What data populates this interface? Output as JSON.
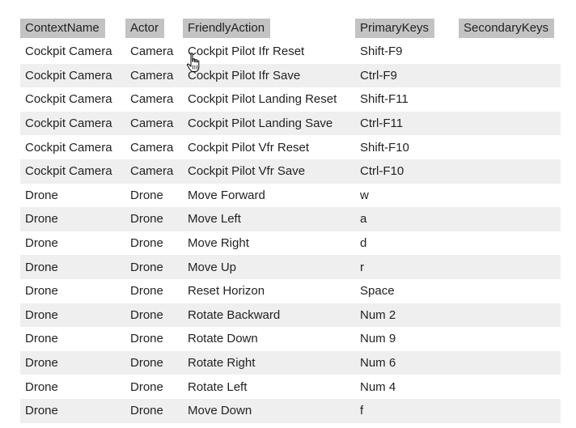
{
  "columns": [
    "ContextName",
    "Actor",
    "FriendlyAction",
    "PrimaryKeys",
    "SecondaryKeys"
  ],
  "rows": [
    [
      "Cockpit Camera",
      "Camera",
      "Cockpit Pilot Ifr Reset",
      "Shift-F9",
      ""
    ],
    [
      "Cockpit Camera",
      "Camera",
      "Cockpit Pilot Ifr Save",
      "Ctrl-F9",
      ""
    ],
    [
      "Cockpit Camera",
      "Camera",
      "Cockpit Pilot Landing Reset",
      "Shift-F11",
      ""
    ],
    [
      "Cockpit Camera",
      "Camera",
      "Cockpit Pilot Landing Save",
      "Ctrl-F11",
      ""
    ],
    [
      "Cockpit Camera",
      "Camera",
      "Cockpit Pilot Vfr Reset",
      "Shift-F10",
      ""
    ],
    [
      "Cockpit Camera",
      "Camera",
      "Cockpit Pilot Vfr Save",
      "Ctrl-F10",
      ""
    ],
    [
      "Drone",
      "Drone",
      "Move Forward",
      "w",
      ""
    ],
    [
      "Drone",
      "Drone",
      "Move Left",
      "a",
      ""
    ],
    [
      "Drone",
      "Drone",
      "Move Right",
      "d",
      ""
    ],
    [
      "Drone",
      "Drone",
      "Move Up",
      "r",
      ""
    ],
    [
      "Drone",
      "Drone",
      "Reset Horizon",
      "Space",
      ""
    ],
    [
      "Drone",
      "Drone",
      "Rotate Backward",
      "Num 2",
      ""
    ],
    [
      "Drone",
      "Drone",
      "Rotate Down",
      "Num 9",
      ""
    ],
    [
      "Drone",
      "Drone",
      "Rotate Right",
      "Num 6",
      ""
    ],
    [
      "Drone",
      "Drone",
      "Rotate Left",
      "Num 4",
      ""
    ],
    [
      "Drone",
      "Drone",
      "Move Down",
      "f",
      ""
    ]
  ],
  "colors": {
    "header_bg": "#c3c3c3",
    "stripe_bg": "#efefef"
  },
  "cursor": "hand-pointer-icon"
}
